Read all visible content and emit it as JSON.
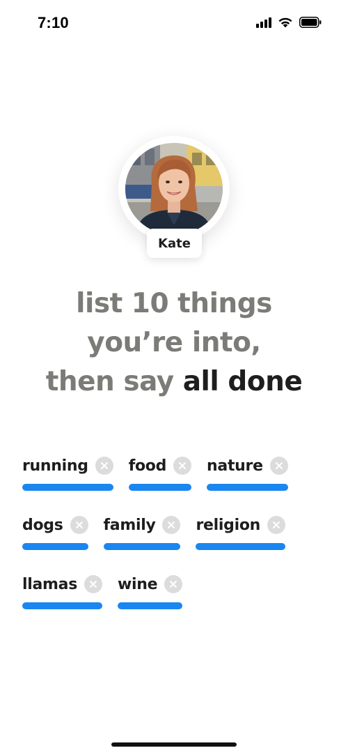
{
  "status_bar": {
    "time": "7:10",
    "icons": [
      "signal-icon",
      "wifi-icon",
      "battery-icon"
    ]
  },
  "profile": {
    "name": "Kate",
    "avatar": "avatar-photo"
  },
  "headline": {
    "line1": "list 10 things",
    "line2": "you’re into,",
    "line3_prefix": "then say ",
    "line3_accent": "all done"
  },
  "tags": [
    {
      "label": "running"
    },
    {
      "label": "food"
    },
    {
      "label": "nature"
    },
    {
      "label": "dogs"
    },
    {
      "label": "family"
    },
    {
      "label": "religion"
    },
    {
      "label": "llamas"
    },
    {
      "label": "wine"
    }
  ],
  "colors": {
    "accent": "#1a86f0",
    "muted_text": "#7b7b78",
    "dark_text": "#1e1e1e",
    "remove_bg": "#dcdcdc"
  }
}
